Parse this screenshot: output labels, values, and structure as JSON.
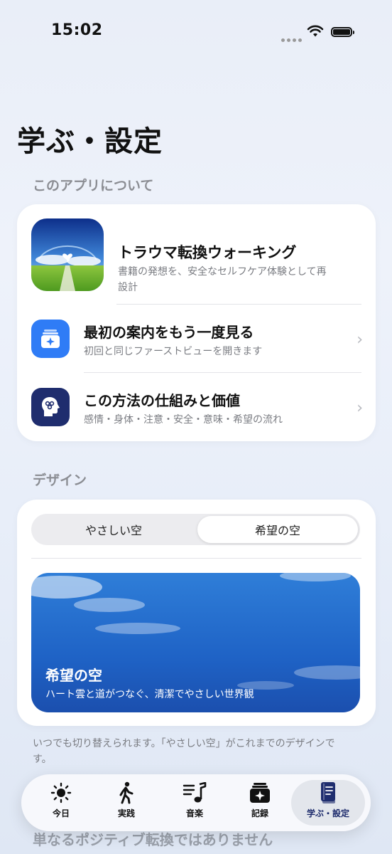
{
  "status_bar": {
    "time": "15:02"
  },
  "page": {
    "title": "学ぶ・設定"
  },
  "about": {
    "header": "このアプリについて",
    "app_name": "トラウマ転換ウォーキング",
    "app_desc": "書籍の発想を、安全なセルフケア体験として再設計",
    "rows": [
      {
        "title": "最初の案内をもう一度見る",
        "subtitle": "初回と同じファーストビューを開きます",
        "icon": "sparkle-card-icon"
      },
      {
        "title": "この方法の仕組みと価値",
        "subtitle": "感情・身体・注意・安全・意味・希望の流れ",
        "icon": "brain-head-icon"
      }
    ]
  },
  "design": {
    "header": "デザイン",
    "options": [
      "やさしい空",
      "希望の空"
    ],
    "selected": "希望の空",
    "preview_title": "希望の空",
    "preview_subtitle": "ハート雲と道がつなぐ、清潔でやさしい世界観",
    "note": "いつでも切り替えられます。「やさしい空」がこれまでのデザインです。"
  },
  "next_section": {
    "text": "単なるポジティブ転換ではありません"
  },
  "tabs": [
    {
      "label": "今日",
      "icon": "sun-icon"
    },
    {
      "label": "実践",
      "icon": "walking-icon"
    },
    {
      "label": "音楽",
      "icon": "music-list-icon"
    },
    {
      "label": "記録",
      "icon": "journal-sparkle-icon"
    },
    {
      "label": "学ぶ・設定",
      "icon": "book-icon",
      "active": true
    }
  ],
  "colors": {
    "accent_blue": "#2f7cf6",
    "navy": "#1f2d6e",
    "sky_blue": "#1f63c6"
  }
}
